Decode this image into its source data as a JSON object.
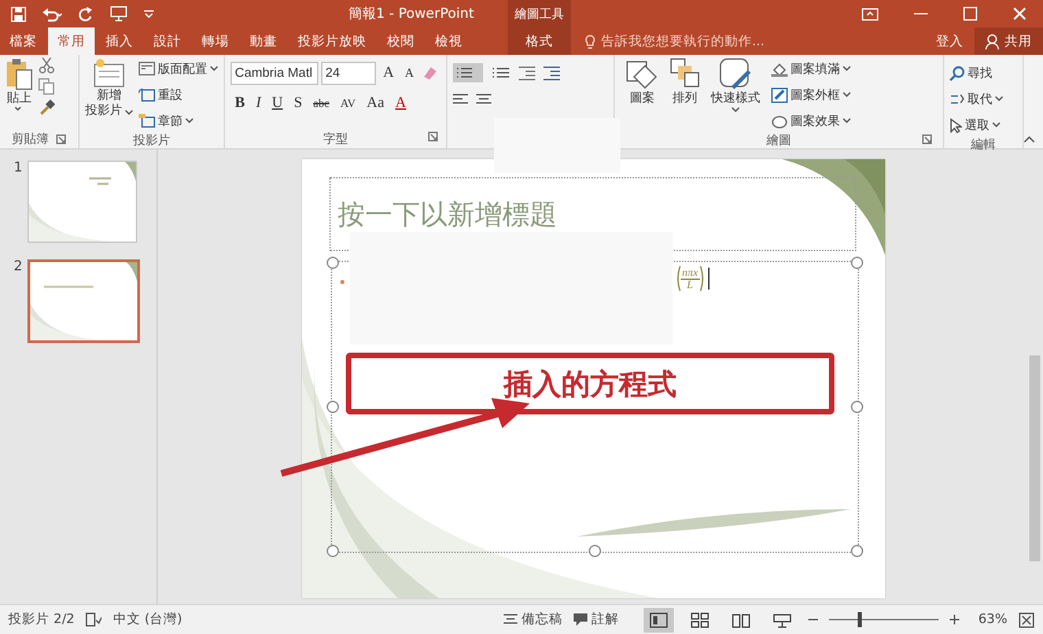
{
  "window": {
    "title": "簡報1 - PowerPoint",
    "contextual_title": "繪圖工具"
  },
  "tabs": [
    {
      "label": "檔案",
      "selected": false
    },
    {
      "label": "常用",
      "selected": true
    },
    {
      "label": "插入",
      "selected": false
    },
    {
      "label": "設計",
      "selected": false
    },
    {
      "label": "轉場",
      "selected": false
    },
    {
      "label": "動畫",
      "selected": false
    },
    {
      "label": "投影片放映",
      "selected": false
    },
    {
      "label": "校閱",
      "selected": false
    },
    {
      "label": "檢視",
      "selected": false
    }
  ],
  "contextual_tab": {
    "label": "格式"
  },
  "tell_me": {
    "placeholder": "告訴我您想要執行的動作..."
  },
  "sign_in": "登入",
  "share": "共用",
  "clipboard": {
    "label": "剪貼簿",
    "paste": "貼上"
  },
  "slides_group": {
    "label": "投影片",
    "new_slide": [
      "新增",
      "投影片"
    ],
    "layout": "版面配置",
    "reset": "重設",
    "section": "章節"
  },
  "font": {
    "label": "字型",
    "font_name": "Cambria Matl",
    "font_size": "24",
    "grow_shrink": [
      "A",
      "A"
    ],
    "format_buttons": [
      "B",
      "I",
      "U",
      "S",
      "abc",
      "AV",
      "Aa",
      "A"
    ]
  },
  "drawing": {
    "label": "繪圖",
    "shapes": "圖案",
    "arrange": "排列",
    "quick_styles": "快速樣式",
    "fill": "圖案填滿",
    "outline": "圖案外框",
    "effects": "圖案效果"
  },
  "editing": {
    "label": "編輯",
    "find": "尋找",
    "replace": "取代",
    "select": "選取"
  },
  "thumbnails": [
    {
      "number": "1",
      "selected": false
    },
    {
      "number": "2",
      "selected": true
    }
  ],
  "slide": {
    "title_placeholder": "按一下以新增標題",
    "equation": {
      "numerator": "nπx",
      "denominator": "L"
    }
  },
  "annotation": {
    "text": "插入的方程式"
  },
  "status_bar": {
    "slide_info": "投影片 2/2",
    "language": "中文 (台灣)",
    "notes": "備忘稿",
    "comments": "註解",
    "views": [
      {
        "kind": "normal",
        "selected": true
      },
      {
        "kind": "sorter",
        "selected": false
      },
      {
        "kind": "reading",
        "selected": false
      },
      {
        "kind": "show",
        "selected": false
      }
    ],
    "zoom": {
      "level": 0.27,
      "reading": "63%"
    }
  }
}
